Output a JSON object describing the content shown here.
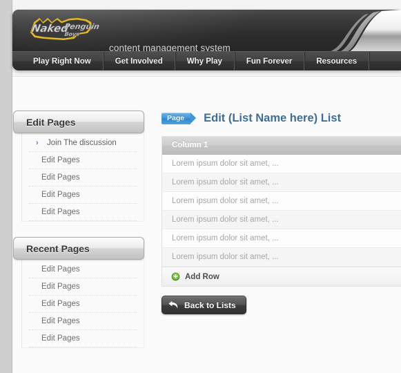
{
  "brand": {
    "logo_text": "Naked Penguin Boys",
    "logo_line1": "Naked Penguin",
    "logo_line2": "Boys",
    "tagline": "content management system",
    "logo_outline_color": "#e8b820",
    "logo_fill_color": "#d9d9d9"
  },
  "nav": {
    "items": [
      {
        "label": "Play Right Now"
      },
      {
        "label": "Get Involved"
      },
      {
        "label": "Why Play"
      },
      {
        "label": "Fun Forever"
      },
      {
        "label": "Resources"
      }
    ]
  },
  "sidebar": {
    "panels": [
      {
        "title": "Edit Pages",
        "items": [
          {
            "label": "Join The discussion",
            "icon": "chevron-right-icon",
            "has_chevron": true
          },
          {
            "label": "Edit Pages",
            "has_chevron": false
          },
          {
            "label": "Edit Pages",
            "has_chevron": false
          },
          {
            "label": "Edit Pages",
            "has_chevron": false
          },
          {
            "label": "Edit Pages",
            "has_chevron": false
          }
        ]
      },
      {
        "title": "Recent Pages",
        "items": [
          {
            "label": "Edit Pages",
            "has_chevron": false
          },
          {
            "label": "Edit Pages",
            "has_chevron": false
          },
          {
            "label": "Edit Pages",
            "has_chevron": false
          },
          {
            "label": "Edit Pages",
            "has_chevron": false
          },
          {
            "label": "Edit Pages",
            "has_chevron": false
          }
        ]
      }
    ]
  },
  "main": {
    "badge_label": "Page",
    "title": "Edit (List Name here) List",
    "title_color": "#3f6d96",
    "badge_color": "#3f94d8",
    "table": {
      "columns": [
        "Column 1"
      ],
      "rows": [
        [
          "Lorem ipsum dolor sit amet, ..."
        ],
        [
          "Lorem ipsum dolor sit amet, ..."
        ],
        [
          "Lorem ipsum dolor sit amet, ..."
        ],
        [
          "Lorem ipsum dolor sit amet, ..."
        ],
        [
          "Lorem ipsum dolor sit amet, ..."
        ],
        [
          "Lorem ipsum dolor sit amet, ..."
        ]
      ],
      "add_row_label": "Add Row",
      "add_row_icon": "plus-circle-icon",
      "add_row_icon_color": "#5aa829"
    },
    "back_button": {
      "label": "Back to Lists",
      "icon": "undo-arrow-icon"
    }
  }
}
